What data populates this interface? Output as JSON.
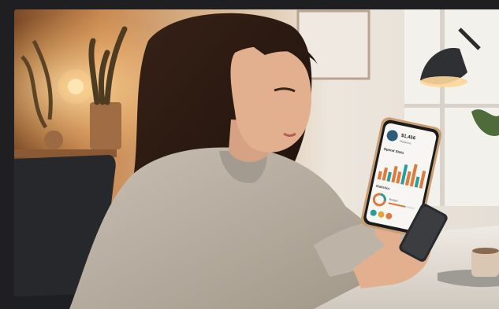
{
  "scene": {
    "description_icon": "photo-icon",
    "colors": {
      "frame": "#1f1f21",
      "wall_warm": "#c98a52",
      "wall_light": "#e9e3da",
      "sweater": "#b7ad9f",
      "hair": "#2a1a12",
      "skin": "#e3b08f",
      "phone_body": "#1b1b1d",
      "table": "#e6e1da",
      "chart_orange": "#e07a3c",
      "chart_teal": "#2a9d9c"
    }
  },
  "phone_screen": {
    "header_value": "$1,456",
    "header_sub": "Balance",
    "section_title": "Spend Stats",
    "section2_title": "Statistics",
    "section3_title": "Budget",
    "bar_values": [
      0.35,
      0.55,
      0.4,
      0.7,
      0.5,
      0.85,
      0.6,
      0.95,
      0.45,
      0.75
    ]
  }
}
